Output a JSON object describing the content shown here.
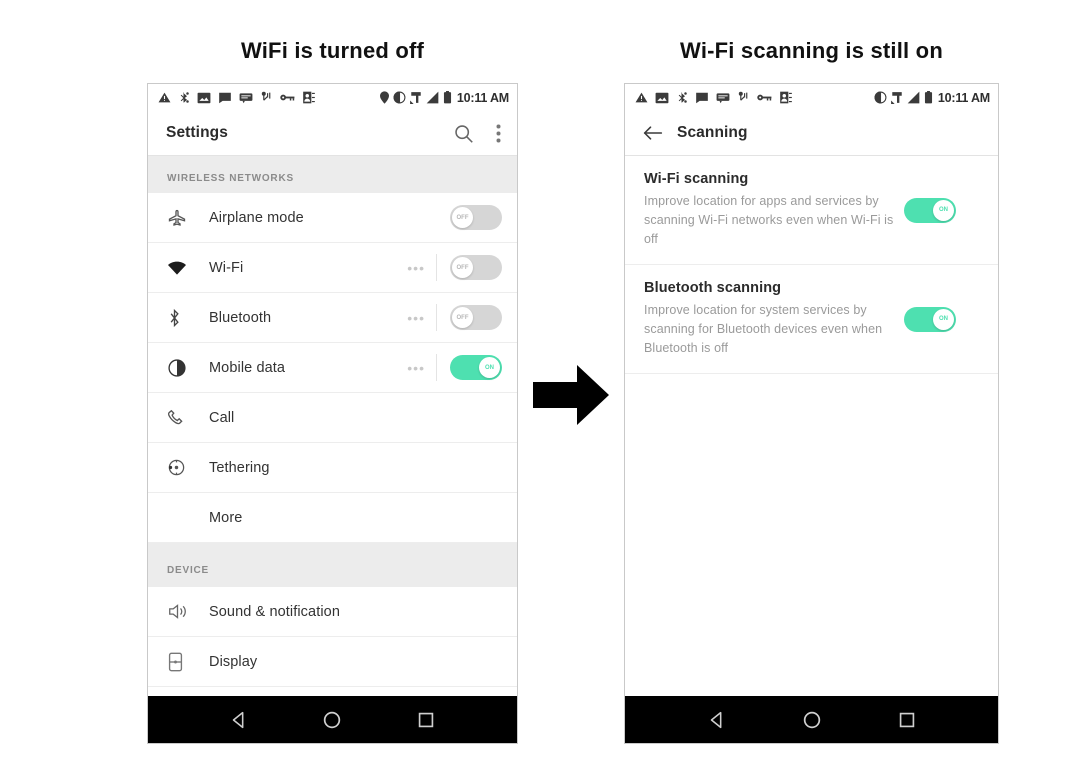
{
  "captions": {
    "left": "WiFi is turned off",
    "right": "Wi-Fi scanning is still on"
  },
  "colors": {
    "toggle_on": "#4ee0b0",
    "toggle_off": "#d6d6d6",
    "section_bg": "#ececec",
    "navbar_bg": "#000000",
    "text_primary": "#333333",
    "text_secondary": "#9a9a9a"
  },
  "left_phone": {
    "statusbar": {
      "left_icons": [
        "warning-triangle-icon",
        "bluetooth-share-icon",
        "image-download-icon",
        "message-icon",
        "sms-icon",
        "nfc-icon",
        "key-icon",
        "contacts-icon"
      ],
      "right_icons": [
        "location-pin-icon",
        "do-not-disturb-icon",
        "mobile-network-icon",
        "signal-bars-icon",
        "battery-icon"
      ],
      "time": "10:11 AM"
    },
    "appbar": {
      "title": "Settings",
      "search_icon": "search-icon",
      "overflow_icon": "overflow-menu-icon"
    },
    "sections": [
      {
        "header": "WIRELESS NETWORKS",
        "rows": [
          {
            "icon": "airplane-icon",
            "label": "Airplane mode",
            "toggle": "off",
            "toggle_label": "OFF",
            "ellipsis": false
          },
          {
            "icon": "wifi-icon",
            "label": "Wi-Fi",
            "toggle": "off",
            "toggle_label": "OFF",
            "ellipsis": true
          },
          {
            "icon": "bluetooth-icon",
            "label": "Bluetooth",
            "toggle": "off",
            "toggle_label": "OFF",
            "ellipsis": true
          },
          {
            "icon": "mobile-data-icon",
            "label": "Mobile data",
            "toggle": "on",
            "toggle_label": "ON",
            "ellipsis": true
          },
          {
            "icon": "call-icon",
            "label": "Call",
            "toggle": null,
            "toggle_label": "",
            "ellipsis": false
          },
          {
            "icon": "tethering-icon",
            "label": "Tethering",
            "toggle": null,
            "toggle_label": "",
            "ellipsis": false
          },
          {
            "icon": null,
            "label": "More",
            "toggle": null,
            "toggle_label": "",
            "ellipsis": false
          }
        ]
      },
      {
        "header": "DEVICE",
        "rows": [
          {
            "icon": "sound-icon",
            "label": "Sound & notification",
            "toggle": null,
            "toggle_label": "",
            "ellipsis": false
          },
          {
            "icon": "display-icon",
            "label": "Display",
            "toggle": null,
            "toggle_label": "",
            "ellipsis": false
          }
        ]
      }
    ],
    "navbar": {
      "back": "back-nav-icon",
      "home": "home-nav-icon",
      "recents": "recents-nav-icon"
    }
  },
  "right_phone": {
    "statusbar": {
      "left_icons": [
        "warning-triangle-icon",
        "image-download-icon",
        "bluetooth-share-icon",
        "message-icon",
        "sms-icon",
        "nfc-icon",
        "key-icon",
        "contacts-icon"
      ],
      "right_icons": [
        "do-not-disturb-icon",
        "mobile-network-icon",
        "signal-bars-icon",
        "battery-icon"
      ],
      "time": "10:11 AM"
    },
    "appbar": {
      "back_icon": "back-arrow-icon",
      "title": "Scanning"
    },
    "items": [
      {
        "title": "Wi-Fi scanning",
        "description": "Improve location for apps and services by scanning Wi-Fi networks even when Wi-Fi is off",
        "toggle": "on",
        "toggle_label": "ON"
      },
      {
        "title": "Bluetooth scanning",
        "description": "Improve location for system services by scanning for Bluetooth devices even when Bluetooth is off",
        "toggle": "on",
        "toggle_label": "ON"
      }
    ],
    "navbar": {
      "back": "back-nav-icon",
      "home": "home-nav-icon",
      "recents": "recents-nav-icon"
    }
  },
  "flow": {
    "arrow": "right-arrow-icon"
  }
}
